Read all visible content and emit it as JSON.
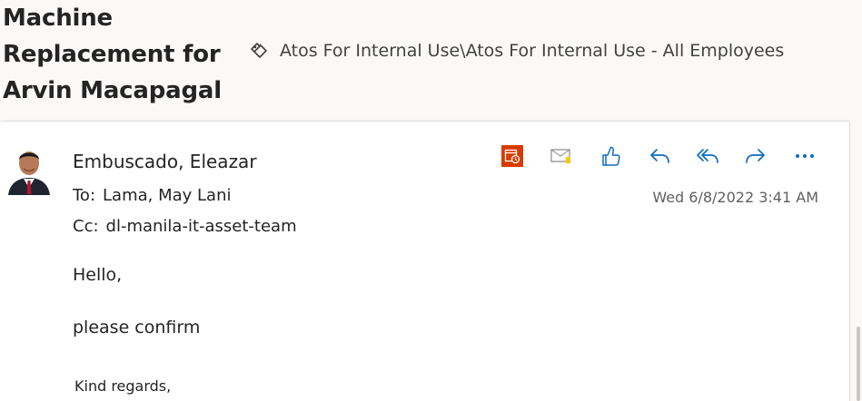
{
  "subject": {
    "lines": [
      "Machine",
      "Replacement for",
      "Arvin Macapagal"
    ]
  },
  "label": {
    "icon": "label-tag-icon",
    "text": "Atos For Internal Use\\Atos For Internal Use - All Employees"
  },
  "message": {
    "sender": "Embuscado, Eleazar",
    "to_prefix": "To:",
    "to": "Lama, May Lani",
    "cc_prefix": "Cc:",
    "cc": "dl-manila-it-asset-team",
    "timestamp": "Wed 6/8/2022 3:41 AM",
    "body": {
      "greeting": "Hello,",
      "line": "please confirm",
      "closing": "Kind regards,"
    }
  },
  "actions": [
    {
      "name": "calendar-icon"
    },
    {
      "name": "envelope-icon"
    },
    {
      "name": "like-icon"
    },
    {
      "name": "reply-icon"
    },
    {
      "name": "reply-all-icon"
    },
    {
      "name": "forward-icon"
    },
    {
      "name": "more-icon"
    }
  ],
  "colors": {
    "accent": "#0f6cbd",
    "calendar": "#d83b01",
    "text": "#242424",
    "muted": "#616161"
  }
}
